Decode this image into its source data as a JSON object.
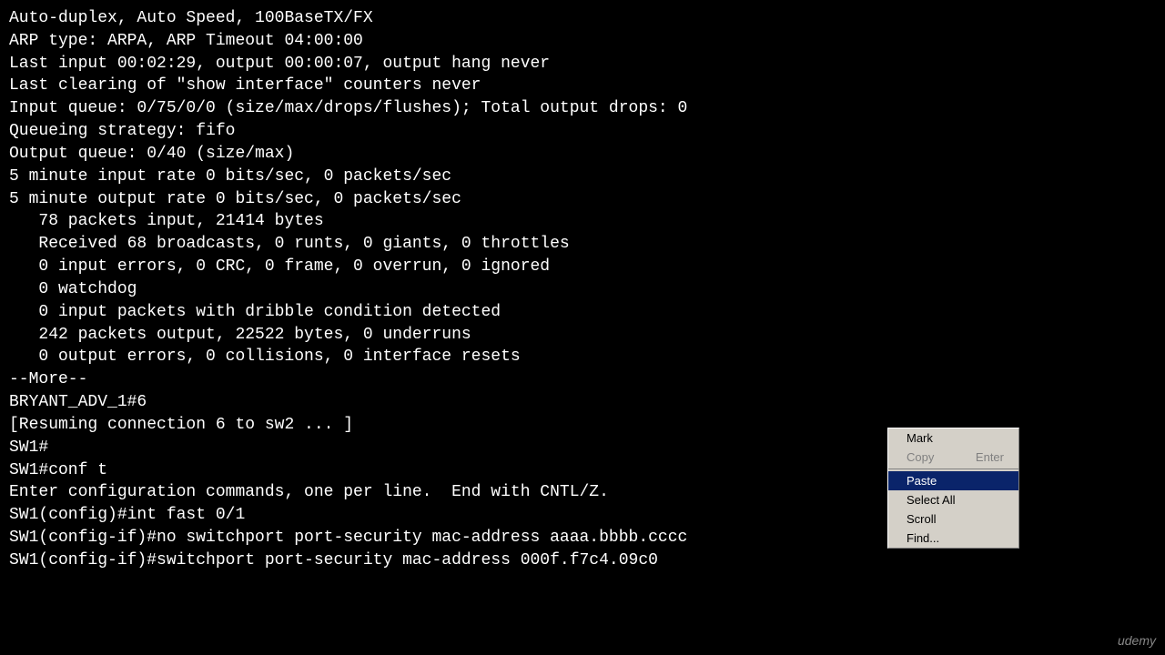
{
  "terminal": {
    "lines": [
      "Auto-duplex, Auto Speed, 100BaseTX/FX",
      "ARP type: ARPA, ARP Timeout 04:00:00",
      "Last input 00:02:29, output 00:00:07, output hang never",
      "Last clearing of \"show interface\" counters never",
      "Input queue: 0/75/0/0 (size/max/drops/flushes); Total output drops: 0",
      "Queueing strategy: fifo",
      "Output queue: 0/40 (size/max)",
      "5 minute input rate 0 bits/sec, 0 packets/sec",
      "5 minute output rate 0 bits/sec, 0 packets/sec",
      "   78 packets input, 21414 bytes",
      "   Received 68 broadcasts, 0 runts, 0 giants, 0 throttles",
      "   0 input errors, 0 CRC, 0 frame, 0 overrun, 0 ignored",
      "   0 watchdog",
      "   0 input packets with dribble condition detected",
      "   242 packets output, 22522 bytes, 0 underruns",
      "   0 output errors, 0 collisions, 0 interface resets",
      "--More--",
      "BRYANT_ADV_1#6",
      "[Resuming connection 6 to sw2 ... ]",
      "",
      "SW1#",
      "SW1#conf t",
      "Enter configuration commands, one per line.  End with CNTL/Z.",
      "SW1(config)#int fast 0/1",
      "SW1(config-if)#no switchport port-security mac-address aaaa.bbbb.cccc",
      "SW1(config-if)#switchport port-security mac-address 000f.f7c4.09c0"
    ]
  },
  "context_menu": {
    "items": [
      {
        "label": "Mark",
        "shortcut": "",
        "disabled": false,
        "highlighted": false,
        "id": "mark"
      },
      {
        "label": "Copy",
        "shortcut": "Enter",
        "disabled": true,
        "highlighted": false,
        "id": "copy"
      },
      {
        "label": "Paste",
        "shortcut": "",
        "disabled": false,
        "highlighted": true,
        "id": "paste"
      },
      {
        "label": "Select All",
        "shortcut": "",
        "disabled": false,
        "highlighted": false,
        "id": "select-all"
      },
      {
        "label": "Scroll",
        "shortcut": "",
        "disabled": false,
        "highlighted": false,
        "id": "scroll"
      },
      {
        "label": "Find...",
        "shortcut": "",
        "disabled": false,
        "highlighted": false,
        "id": "find"
      }
    ]
  },
  "watermark": {
    "text": "udemy"
  }
}
